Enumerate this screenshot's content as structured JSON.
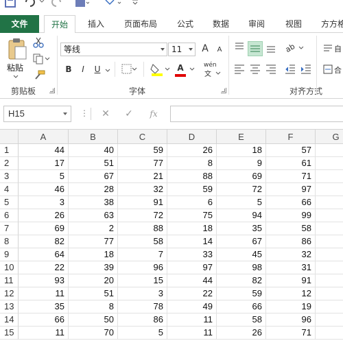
{
  "ribbon_tabs": [
    {
      "label": "文件"
    },
    {
      "label": "开始"
    },
    {
      "label": "插入"
    },
    {
      "label": "页面布局"
    },
    {
      "label": "公式"
    },
    {
      "label": "数据"
    },
    {
      "label": "审阅"
    },
    {
      "label": "视图"
    },
    {
      "label": "方方格"
    }
  ],
  "clipboard": {
    "paste_label": "粘贴",
    "group_label": "剪贴板"
  },
  "font": {
    "name": "等线",
    "size": "11",
    "bold": "B",
    "italic": "I",
    "underline": "U",
    "group_label": "字体",
    "grow_label": "A",
    "shrink_label": "A",
    "color_label": "A",
    "wen_label": "wén"
  },
  "alignment": {
    "group_label": "对齐方式"
  },
  "formula_bar": {
    "name_box": "H15",
    "fx_label": "fx",
    "formula": ""
  },
  "sheet": {
    "columns": [
      "A",
      "B",
      "C",
      "D",
      "E",
      "F",
      "G"
    ],
    "rows": [
      {
        "num": "1",
        "cells": [
          "44",
          "40",
          "59",
          "26",
          "18",
          "57"
        ]
      },
      {
        "num": "2",
        "cells": [
          "17",
          "51",
          "77",
          "8",
          "9",
          "61"
        ]
      },
      {
        "num": "3",
        "cells": [
          "5",
          "67",
          "21",
          "88",
          "69",
          "71"
        ]
      },
      {
        "num": "4",
        "cells": [
          "46",
          "28",
          "32",
          "59",
          "72",
          "97"
        ]
      },
      {
        "num": "5",
        "cells": [
          "3",
          "38",
          "91",
          "6",
          "5",
          "66"
        ]
      },
      {
        "num": "6",
        "cells": [
          "26",
          "63",
          "72",
          "75",
          "94",
          "99"
        ]
      },
      {
        "num": "7",
        "cells": [
          "69",
          "2",
          "88",
          "18",
          "35",
          "58"
        ]
      },
      {
        "num": "8",
        "cells": [
          "82",
          "77",
          "58",
          "14",
          "67",
          "86"
        ]
      },
      {
        "num": "9",
        "cells": [
          "64",
          "18",
          "7",
          "33",
          "45",
          "32"
        ]
      },
      {
        "num": "10",
        "cells": [
          "22",
          "39",
          "96",
          "97",
          "98",
          "31"
        ]
      },
      {
        "num": "11",
        "cells": [
          "93",
          "20",
          "15",
          "44",
          "82",
          "91"
        ]
      },
      {
        "num": "12",
        "cells": [
          "11",
          "51",
          "3",
          "22",
          "59",
          "12"
        ]
      },
      {
        "num": "13",
        "cells": [
          "35",
          "8",
          "78",
          "49",
          "66",
          "19"
        ]
      },
      {
        "num": "14",
        "cells": [
          "66",
          "50",
          "86",
          "11",
          "58",
          "96"
        ]
      },
      {
        "num": "15",
        "cells": [
          "11",
          "70",
          "5",
          "11",
          "26",
          "71"
        ]
      }
    ]
  },
  "colors": {
    "excel_green": "#217346",
    "selected_align": "#c6e6d2",
    "highlight_yellow": "#ffff00",
    "font_red": "#e00000"
  }
}
